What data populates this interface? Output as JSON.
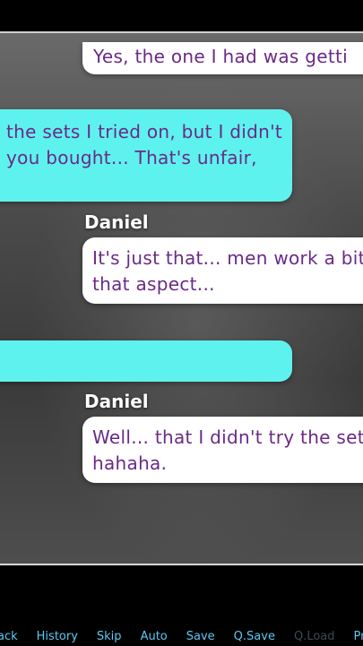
{
  "dialogue": {
    "bubble1_text": "Yes, the one I had was getti",
    "bubble2_line1": "the sets I tried on, but I didn't",
    "bubble2_line2": "you bought... That's unfair,",
    "speaker1": "Daniel",
    "bubble3_line1": "It's just that... men work a bit",
    "bubble3_line2": "that aspect...",
    "bubble4_text": "",
    "speaker2": "Daniel",
    "bubble5_line1": "Well... that I didn't try the set",
    "bubble5_line2": "hahaha."
  },
  "quick_menu": {
    "back": "ack",
    "history": "History",
    "skip": "Skip",
    "auto": "Auto",
    "save": "Save",
    "qsave": "Q.Save",
    "qload": "Q.Load",
    "prefs": "Pre"
  },
  "colors": {
    "bubble_text": "#6a2a86",
    "player_bubble": "#5ef2ee",
    "npc_bubble": "#ffffff",
    "menu_active": "#5ec8f2",
    "menu_disabled": "#3c4a52"
  }
}
